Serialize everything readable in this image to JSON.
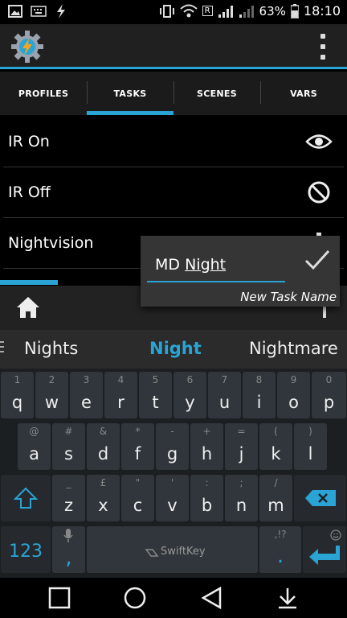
{
  "status_bar": {
    "battery": "63%",
    "time": "18:10",
    "network_label": "R"
  },
  "tabs": [
    {
      "label": "PROFILES",
      "active": false
    },
    {
      "label": "TASKS",
      "active": true
    },
    {
      "label": "SCENES",
      "active": false
    },
    {
      "label": "VARS",
      "active": false
    }
  ],
  "tasks": [
    {
      "name": "IR On",
      "icon": "eye-icon"
    },
    {
      "name": "IR Off",
      "icon": "block-icon"
    },
    {
      "name": "Nightvision",
      "icon": "gear-icon"
    }
  ],
  "dialog": {
    "input_prefix": "MD ",
    "input_underlined": "Night",
    "caption": "New Task Name"
  },
  "suggestions": [
    "Nights",
    "Night",
    "Nightmare"
  ],
  "keyboard": {
    "row1": [
      {
        "k": "q",
        "a": "1"
      },
      {
        "k": "w",
        "a": "2"
      },
      {
        "k": "e",
        "a": "3"
      },
      {
        "k": "r",
        "a": "4"
      },
      {
        "k": "t",
        "a": "5"
      },
      {
        "k": "y",
        "a": "6"
      },
      {
        "k": "u",
        "a": "7"
      },
      {
        "k": "i",
        "a": "8"
      },
      {
        "k": "o",
        "a": "9"
      },
      {
        "k": "p",
        "a": "0"
      }
    ],
    "row2": [
      {
        "k": "a",
        "a": "@"
      },
      {
        "k": "s",
        "a": "#"
      },
      {
        "k": "d",
        "a": "&"
      },
      {
        "k": "f",
        "a": "*"
      },
      {
        "k": "g",
        "a": "-"
      },
      {
        "k": "h",
        "a": "+"
      },
      {
        "k": "j",
        "a": "="
      },
      {
        "k": "k",
        "a": "("
      },
      {
        "k": "l",
        "a": ")"
      }
    ],
    "row3": [
      {
        "k": "z",
        "a": "_"
      },
      {
        "k": "x",
        "a": "£"
      },
      {
        "k": "c",
        "a": "\""
      },
      {
        "k": "v",
        "a": "'"
      },
      {
        "k": "b",
        "a": ":"
      },
      {
        "k": "n",
        "a": ";"
      },
      {
        "k": "m",
        "a": "/"
      }
    ],
    "num_key": "123",
    "comma_key": ",",
    "period_key": ".",
    "period_alt": ",!?",
    "brand": "SwiftKey"
  },
  "colors": {
    "accent": "#2aa4d4"
  }
}
